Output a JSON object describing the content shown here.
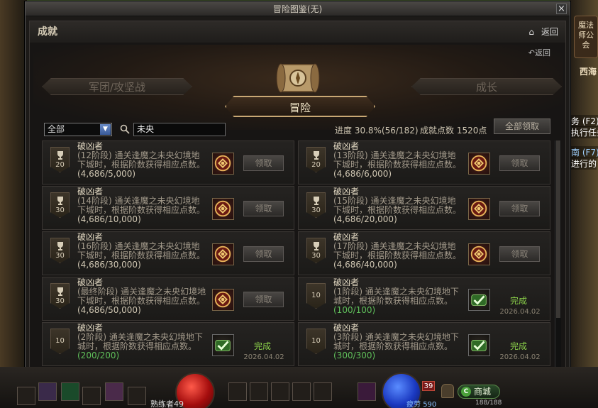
{
  "window": {
    "title": "冒险图鉴(无)",
    "close": "×"
  },
  "header": {
    "title": "成就",
    "back_label": "返回"
  },
  "stage": {
    "back_label": "返回",
    "tab_legion": "军团/攻坚战",
    "tab_adventure": "冒险",
    "tab_growth": "成长"
  },
  "filters": {
    "category": "全部",
    "search_value": "未央",
    "progress": "进度 30.8%(56/182)",
    "points": "成就点数 1520点",
    "claim_all": "全部领取"
  },
  "cards": [
    {
      "title": "破凶者",
      "desc": "(12阶段) 通关逢魔之未央幻境地下城时，根据阶数获得相应点数。",
      "progress": "(4,686/5,000)",
      "points": "20",
      "state": "claim",
      "claim_label": "领取"
    },
    {
      "title": "破凶者",
      "desc": "(13阶段) 通关逢魔之未央幻境地下城时，根据阶数获得相应点数。",
      "progress": "(4,686/6,000)",
      "points": "20",
      "state": "claim",
      "claim_label": "领取"
    },
    {
      "title": "破凶者",
      "desc": "(14阶段) 通关逢魔之未央幻境地下城时，根据阶数获得相应点数。",
      "progress": "(4,686/10,000)",
      "points": "30",
      "state": "claim",
      "claim_label": "领取"
    },
    {
      "title": "破凶者",
      "desc": "(15阶段) 通关逢魔之未央幻境地下城时，根据阶数获得相应点数。",
      "progress": "(4,686/20,000)",
      "points": "30",
      "state": "claim",
      "claim_label": "领取"
    },
    {
      "title": "破凶者",
      "desc": "(16阶段) 通关逢魔之未央幻境地下城时，根据阶数获得相应点数。",
      "progress": "(4,686/30,000)",
      "points": "30",
      "state": "claim",
      "claim_label": "领取"
    },
    {
      "title": "破凶者",
      "desc": "(17阶段) 通关逢魔之未央幻境地下城时，根据阶数获得相应点数。",
      "progress": "(4,686/40,000)",
      "points": "30",
      "state": "claim",
      "claim_label": "领取"
    },
    {
      "title": "破凶者",
      "desc": "(最终阶段) 通关逢魔之未央幻境地下城时，根据阶数获得相应点数。",
      "progress": "(4,686/50,000)",
      "points": "30",
      "state": "claim",
      "claim_label": "领取"
    },
    {
      "title": "破凶者",
      "desc": "(1阶段) 通关逢魔之未央幻境地下城时，根据阶数获得相应点数。",
      "progress": "(100/100)",
      "points": "10",
      "state": "done",
      "done_label": "完成",
      "date": "2026.04.02"
    },
    {
      "title": "破凶者",
      "desc": "(2阶段) 通关逢魔之未央幻境地下城时，根据阶数获得相应点数。",
      "progress": "(200/200)",
      "points": "10",
      "state": "done",
      "done_label": "完成",
      "date": "2026.04.02"
    },
    {
      "title": "破凶者",
      "desc": "(3阶段) 通关逢魔之未央幻境地下城时，根据阶数获得相应点数。",
      "progress": "(300/300)",
      "points": "10",
      "state": "done",
      "done_label": "完成",
      "date": "2026.04.02"
    }
  ],
  "side": {
    "guild": "魔法师公会",
    "west": "西海",
    "q1": "务 (F2)",
    "q1b": "执行任务",
    "q2": "南 (F7)",
    "q2b": "进行的"
  },
  "hud": {
    "character": "熟练者49",
    "fatigue_label": "疲劳",
    "fatigue_value": "590",
    "fatigue_level": "39",
    "shop": "商城",
    "fatigue_bar_text": "188/188"
  },
  "colors": {
    "done_green": "#8bd04a",
    "progress_green": "#5fbf5a",
    "accent_gold": "#c9a874"
  }
}
